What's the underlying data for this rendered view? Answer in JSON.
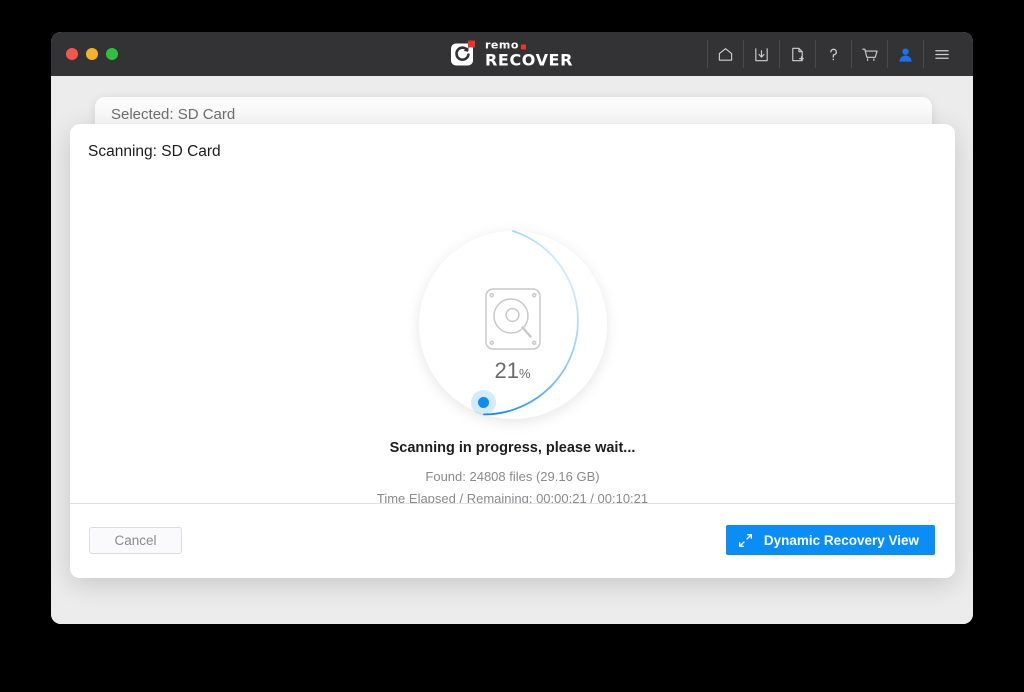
{
  "window": {
    "traffic_lights": [
      "close",
      "minimize",
      "zoom"
    ],
    "logo": {
      "word_mark": "remo",
      "product": "RECOVER",
      "accent_color": "#e8362a"
    },
    "toolbar": [
      {
        "name": "home-icon",
        "label": "Home"
      },
      {
        "name": "save-icon",
        "label": "Save Recovery Session"
      },
      {
        "name": "new-file-icon",
        "label": "New Session"
      },
      {
        "name": "help-icon",
        "label": "Help"
      },
      {
        "name": "cart-icon",
        "label": "Buy Now"
      },
      {
        "name": "account-icon",
        "label": "Account"
      },
      {
        "name": "menu-icon",
        "label": "Menu"
      }
    ]
  },
  "back_card": {
    "title": "Selected: SD Card"
  },
  "modal": {
    "title": "Scanning: SD Card",
    "progress": {
      "percent_value": "21",
      "percent_symbol": "%",
      "percent": 21,
      "accent_color": "#0b8df6",
      "icon": "hard-disk-scan-icon"
    },
    "status_main": "Scanning in progress, please wait...",
    "status_found": "Found: 24808 files (29.16 GB)",
    "status_time": "Time Elapsed / Remaining: 00:00:21 / 00:10:21",
    "footer": {
      "cancel_label": "Cancel",
      "dynamic_label": "Dynamic Recovery View",
      "dynamic_icon": "expand-arrows-icon"
    }
  }
}
